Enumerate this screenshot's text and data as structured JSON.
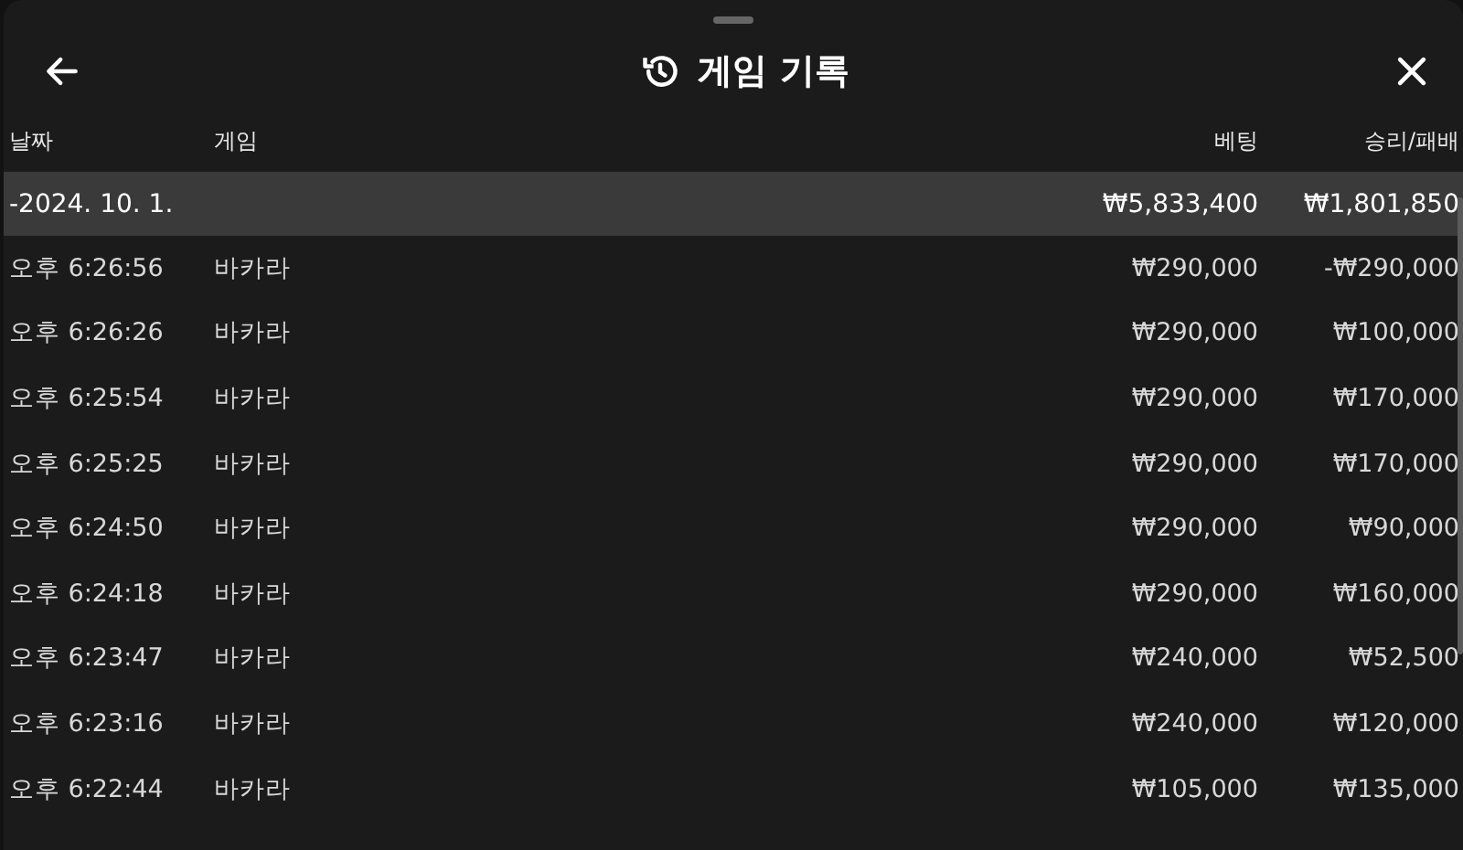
{
  "header": {
    "title": "게임 기록"
  },
  "table": {
    "columns": [
      "날짜",
      "게임",
      "베팅",
      "승리/패배"
    ],
    "group": {
      "date": "-2024. 10. 1.",
      "bet": "₩5,833,400",
      "result": "₩1,801,850"
    },
    "rows": [
      {
        "time": "오후 6:26:56",
        "game": "바카라",
        "bet": "₩290,000",
        "result": "-₩290,000"
      },
      {
        "time": "오후 6:26:26",
        "game": "바카라",
        "bet": "₩290,000",
        "result": "₩100,000"
      },
      {
        "time": "오후 6:25:54",
        "game": "바카라",
        "bet": "₩290,000",
        "result": "₩170,000"
      },
      {
        "time": "오후 6:25:25",
        "game": "바카라",
        "bet": "₩290,000",
        "result": "₩170,000"
      },
      {
        "time": "오후 6:24:50",
        "game": "바카라",
        "bet": "₩290,000",
        "result": "₩90,000"
      },
      {
        "time": "오후 6:24:18",
        "game": "바카라",
        "bet": "₩290,000",
        "result": "₩160,000"
      },
      {
        "time": "오후 6:23:47",
        "game": "바카라",
        "bet": "₩240,000",
        "result": "₩52,500"
      },
      {
        "time": "오후 6:23:16",
        "game": "바카라",
        "bet": "₩240,000",
        "result": "₩120,000"
      },
      {
        "time": "오후 6:22:44",
        "game": "바카라",
        "bet": "₩105,000",
        "result": "₩135,000"
      }
    ]
  }
}
